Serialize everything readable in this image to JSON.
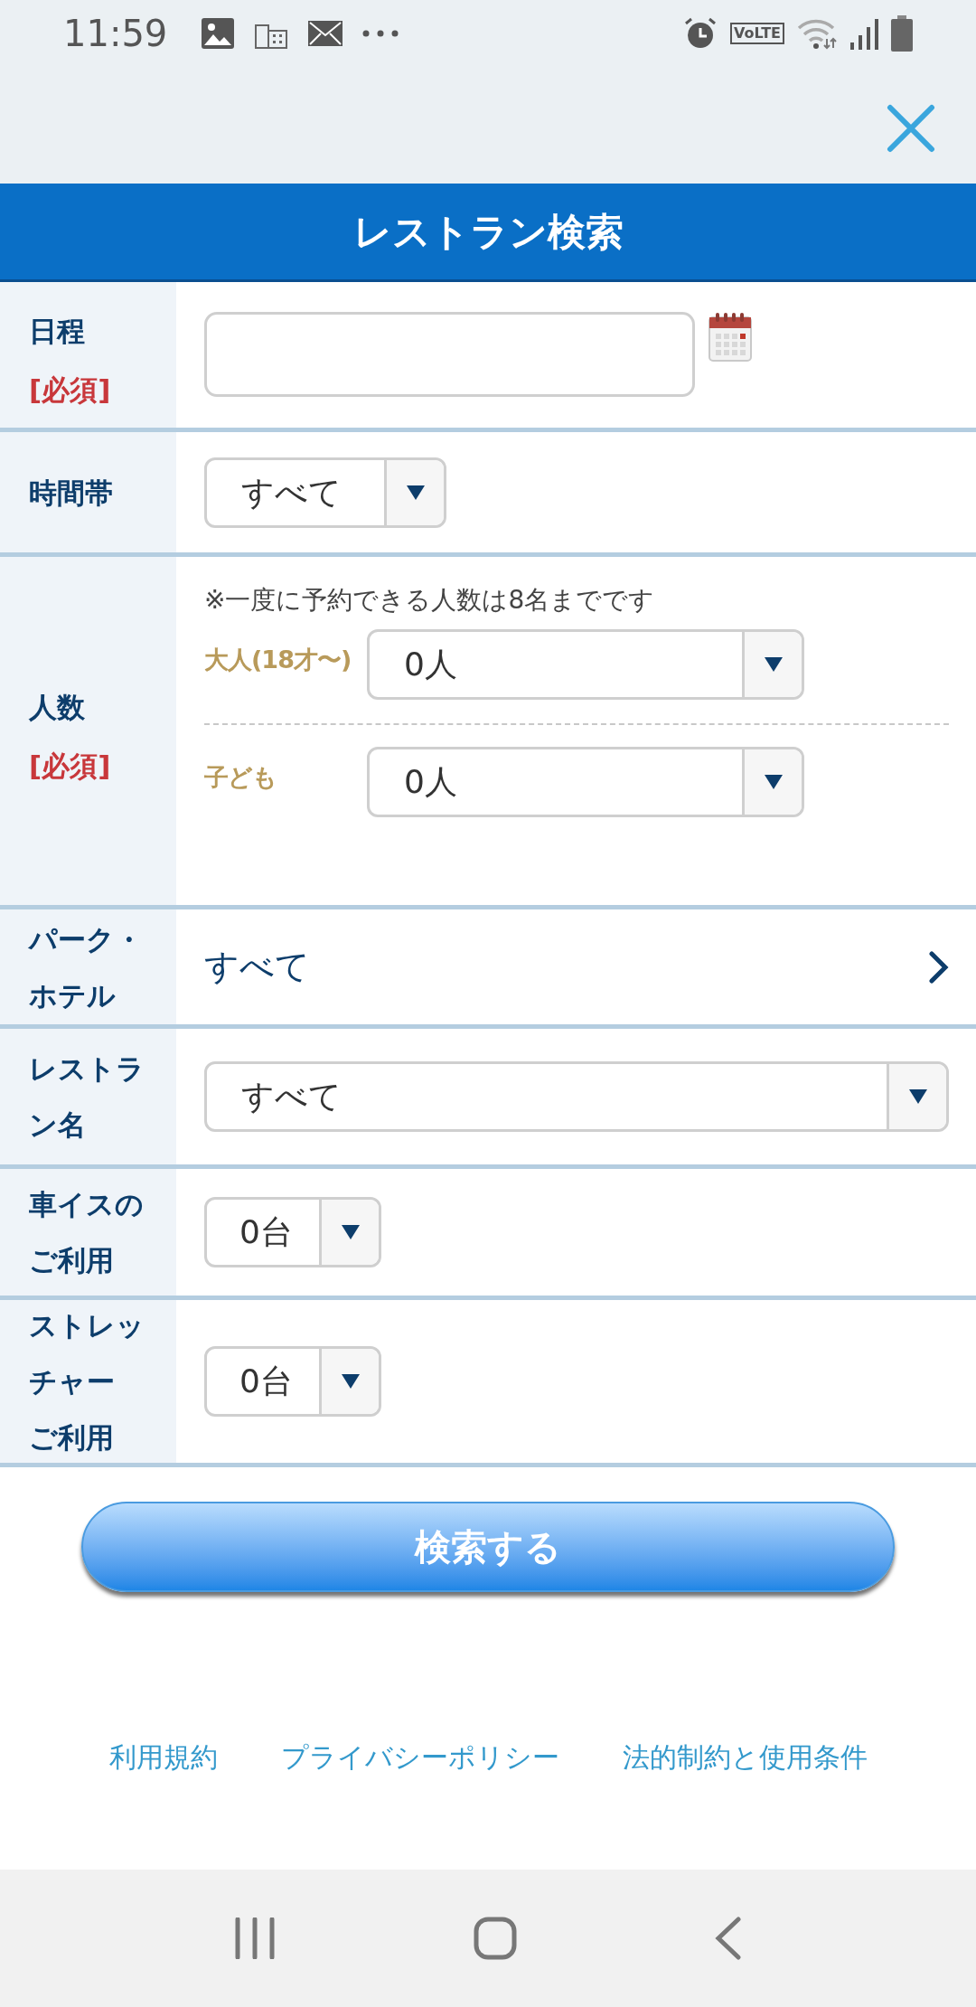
{
  "status_bar": {
    "time": "11:59",
    "network_badge": "VoLTE"
  },
  "header": {
    "title": "レストラン検索"
  },
  "form": {
    "rows": [
      {
        "kind": "date",
        "label": [
          "日程"
        ],
        "required_label": "[必須]"
      },
      {
        "kind": "select",
        "label": [
          "時間帯"
        ],
        "value": "すべて"
      },
      {
        "kind": "people",
        "label": [
          "人数"
        ],
        "required_label": "[必須]",
        "note": "※一度に予約できる人数は8名までです",
        "groups": [
          {
            "label": "大人(18才〜)",
            "value": "0人"
          },
          {
            "label": "子ども",
            "value": "0人"
          }
        ]
      },
      {
        "kind": "link",
        "label": [
          "パーク・ホテル"
        ],
        "value": "すべて"
      },
      {
        "kind": "select",
        "label": [
          "レストラン名"
        ],
        "value": "すべて"
      },
      {
        "kind": "select",
        "label": [
          "車イスのご利用"
        ],
        "value": "0台"
      },
      {
        "kind": "select",
        "label": [
          "ストレッチャー",
          "ご利用"
        ],
        "value": "0台"
      }
    ]
  },
  "search_button": "検索する",
  "footer_links": [
    "利用規約",
    "プライバシーポリシー",
    "法的制約と使用条件"
  ]
}
